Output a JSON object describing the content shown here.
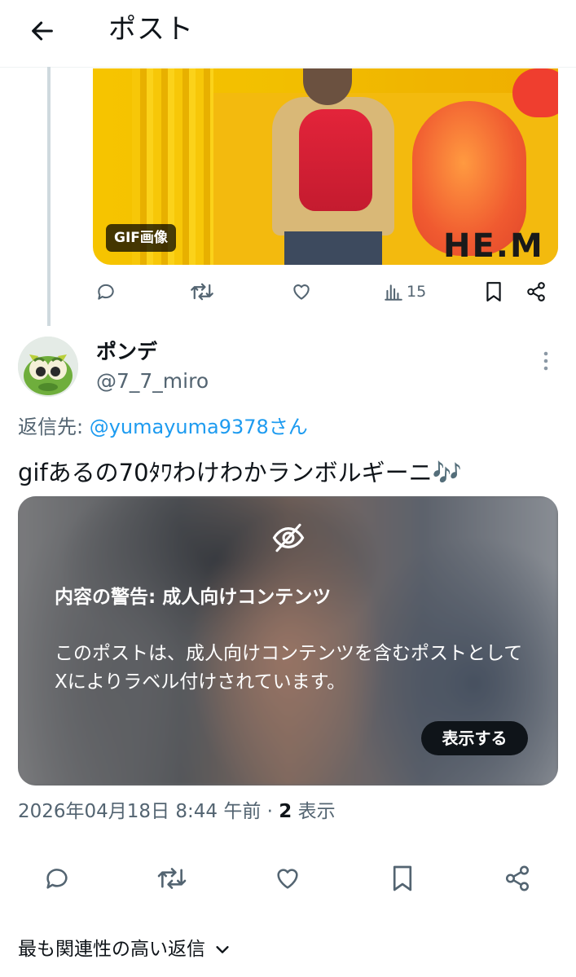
{
  "header": {
    "title": "ポスト"
  },
  "gif": {
    "badge": "GIF画像",
    "overlay_text": "HE.M"
  },
  "parent_actions": {
    "views": "15"
  },
  "reply": {
    "author_name": "ポンデ",
    "author_handle": "@7_7_miro",
    "reply_to_prefix": "返信先: ",
    "reply_to_mention": "@yumayuma9378さん",
    "text": "gifあるの70ﾀﾜわけわかランボルギーニ🎶"
  },
  "warning": {
    "title": "内容の警告: 成人向けコンテンツ",
    "description": "このポストは、成人向けコンテンツを含むポストとしてXによりラベル付けされています。",
    "show_button": "表示する"
  },
  "meta": {
    "datetime": "2026年04月18日 8:44 午前 · ",
    "views_count": "2",
    "views_label": " 表示"
  },
  "relevant_replies": {
    "label": "最も関連性の高い返信"
  },
  "colors": {
    "accent": "#1d9bf0",
    "secondary_text": "#536471",
    "primary_text": "#0f1419"
  }
}
